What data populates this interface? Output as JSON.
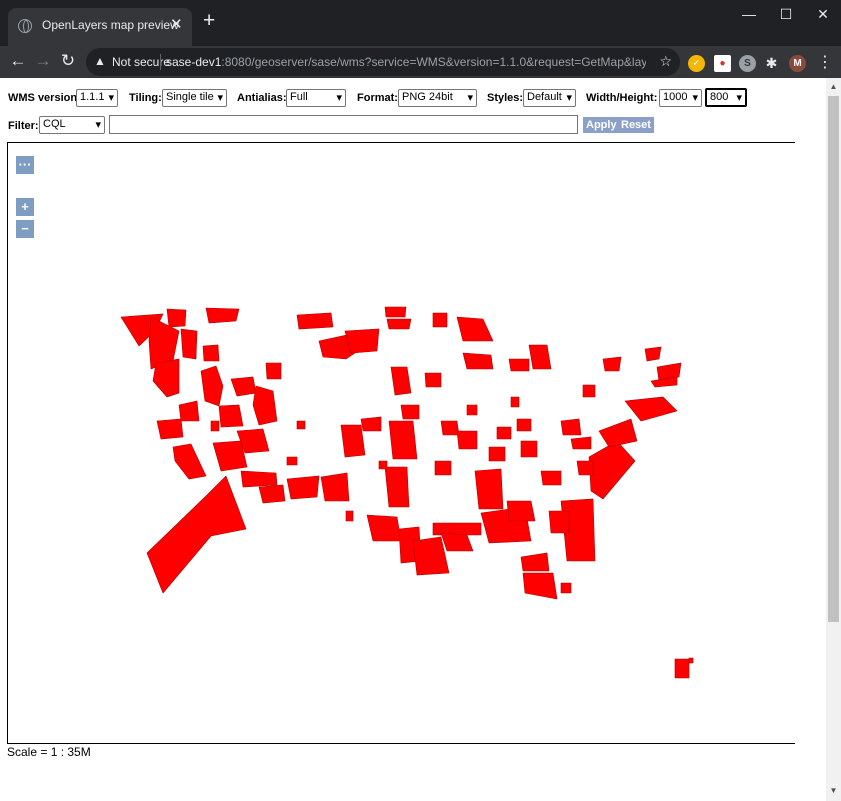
{
  "browser": {
    "tab_title": "OpenLayers map preview",
    "tab_close": "✕",
    "new_tab": "+",
    "window_controls": [
      "—",
      "☐",
      "✕"
    ],
    "security_label": "Not secure",
    "url_host": "sase-dev1",
    "url_rest": ":8080/geoserver/sase/wms?service=WMS&version=1.1.0&request=GetMap&layers=...",
    "profile_initial": "M",
    "extensions": [
      {
        "icon": "norton-icon",
        "glyph": "✓",
        "color": "#f5b800"
      },
      {
        "icon": "shield-ext-icon",
        "glyph": "●",
        "color": "#d9302c"
      },
      {
        "icon": "s-ext-icon",
        "glyph": "S",
        "color": "#5f6368"
      },
      {
        "icon": "puzzle-icon",
        "glyph": "✱",
        "color": "#35363a"
      }
    ]
  },
  "controls": {
    "wms_version_label": "WMS version:",
    "wms_version_value": "1.1.1",
    "tiling_label": "Tiling:",
    "tiling_value": "Single tile",
    "antialias_label": "Antialias:",
    "antialias_value": "Full",
    "format_label": "Format:",
    "format_value": "PNG 24bit",
    "styles_label": "Styles:",
    "styles_value": "Default",
    "wh_label": "Width/Height:",
    "width_value": "1000",
    "height_value": "800",
    "filter_label": "Filter:",
    "filter_type_value": "CQL",
    "filter_text": "",
    "apply_label": "Apply",
    "reset_label": "Reset"
  },
  "map": {
    "toolbar_button": "···",
    "zoom_in": "+",
    "zoom_out": "−",
    "scale_text": "Scale = 1 : 35M",
    "feature_color": "#ff0000"
  }
}
